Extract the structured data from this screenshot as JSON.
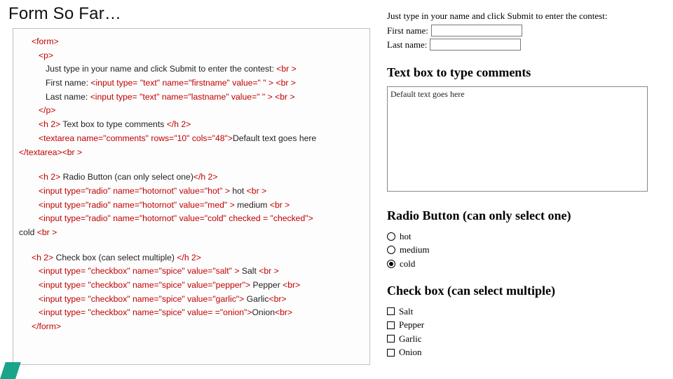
{
  "title": "Form So Far…",
  "code": {
    "l1": "<form>",
    "l2": "<p>",
    "l3_a": "Just type in your name and click Submit to enter the contest: ",
    "l3_b": "<br >",
    "l4_a": "First name: ",
    "l4_b": "<input type= \"text\" name=\"firstname\" value=\" \" >",
    "l4_c": " <br >",
    "l5_a": "Last name: ",
    "l5_b": "<input type= \"text\" name=\"lastname\" value=\" \" >",
    "l5_c": " <br >",
    "l6": "</p>",
    "l7_a": "<h 2>",
    "l7_b": " Text box to type comments ",
    "l7_c": "</h 2>",
    "l8_a": "<textarea name=\"comments\" rows=\"10\" cols=\"48\">",
    "l8_b": "Default text goes here",
    "l8_c": "</textarea><br >",
    "l9_a": "<h 2>",
    "l9_b": " Radio Button (can only select one)",
    "l9_c": "</h 2>",
    "l10_a": "<input type=\"radio\" name=\"hotornot\" value=\"hot\" >",
    "l10_b": " hot ",
    "l10_c": "<br >",
    "l11_a": "<input type=\"radio\" name=\"hotornot\" value=\"med\" >",
    "l11_b": " medium ",
    "l11_c": "<br >",
    "l12_a": "<input type=\"radio\" name=\"hotornot\" value=\"cold\"  checked = \"checked\">",
    "l12_b": " cold ",
    "l12_c": "<br >",
    "l13_a": "<h 2>",
    "l13_b": " Check box (can select multiple) ",
    "l13_c": "</h 2>",
    "l14_a": "<input type= \"checkbox\" name=\"spice\" value=\"salt\" >",
    "l14_b": " Salt ",
    "l14_c": "<br >",
    "l15_a": "<input type= \"checkbox\" name=\"spice\" value=\"pepper\">",
    "l15_b": " Pepper ",
    "l15_c": "<br>",
    "l16_a": "<input type= \"checkbox\" name=\"spice\" value=\"garlic\">",
    "l16_b": " Garlic",
    "l16_c": "<br>",
    "l17_a": "<input type= \"checkbox\" name=\"spice\" value= =\"onion\">",
    "l17_b": "Onion",
    "l17_c": "<br>",
    "l18": "</form>"
  },
  "preview": {
    "intro": "Just type in your name and click Submit to enter the contest:",
    "first_label": "First name:",
    "last_label": "Last name:",
    "h_textbox": "Text box to type comments",
    "textarea_value": "Default text goes here",
    "h_radio": "Radio Button (can only select one)",
    "radio": {
      "opt1": "hot",
      "opt2": "medium",
      "opt3": "cold"
    },
    "h_check": "Check box (can select multiple)",
    "check": {
      "opt1": "Salt",
      "opt2": "Pepper",
      "opt3": "Garlic",
      "opt4": "Onion"
    }
  }
}
